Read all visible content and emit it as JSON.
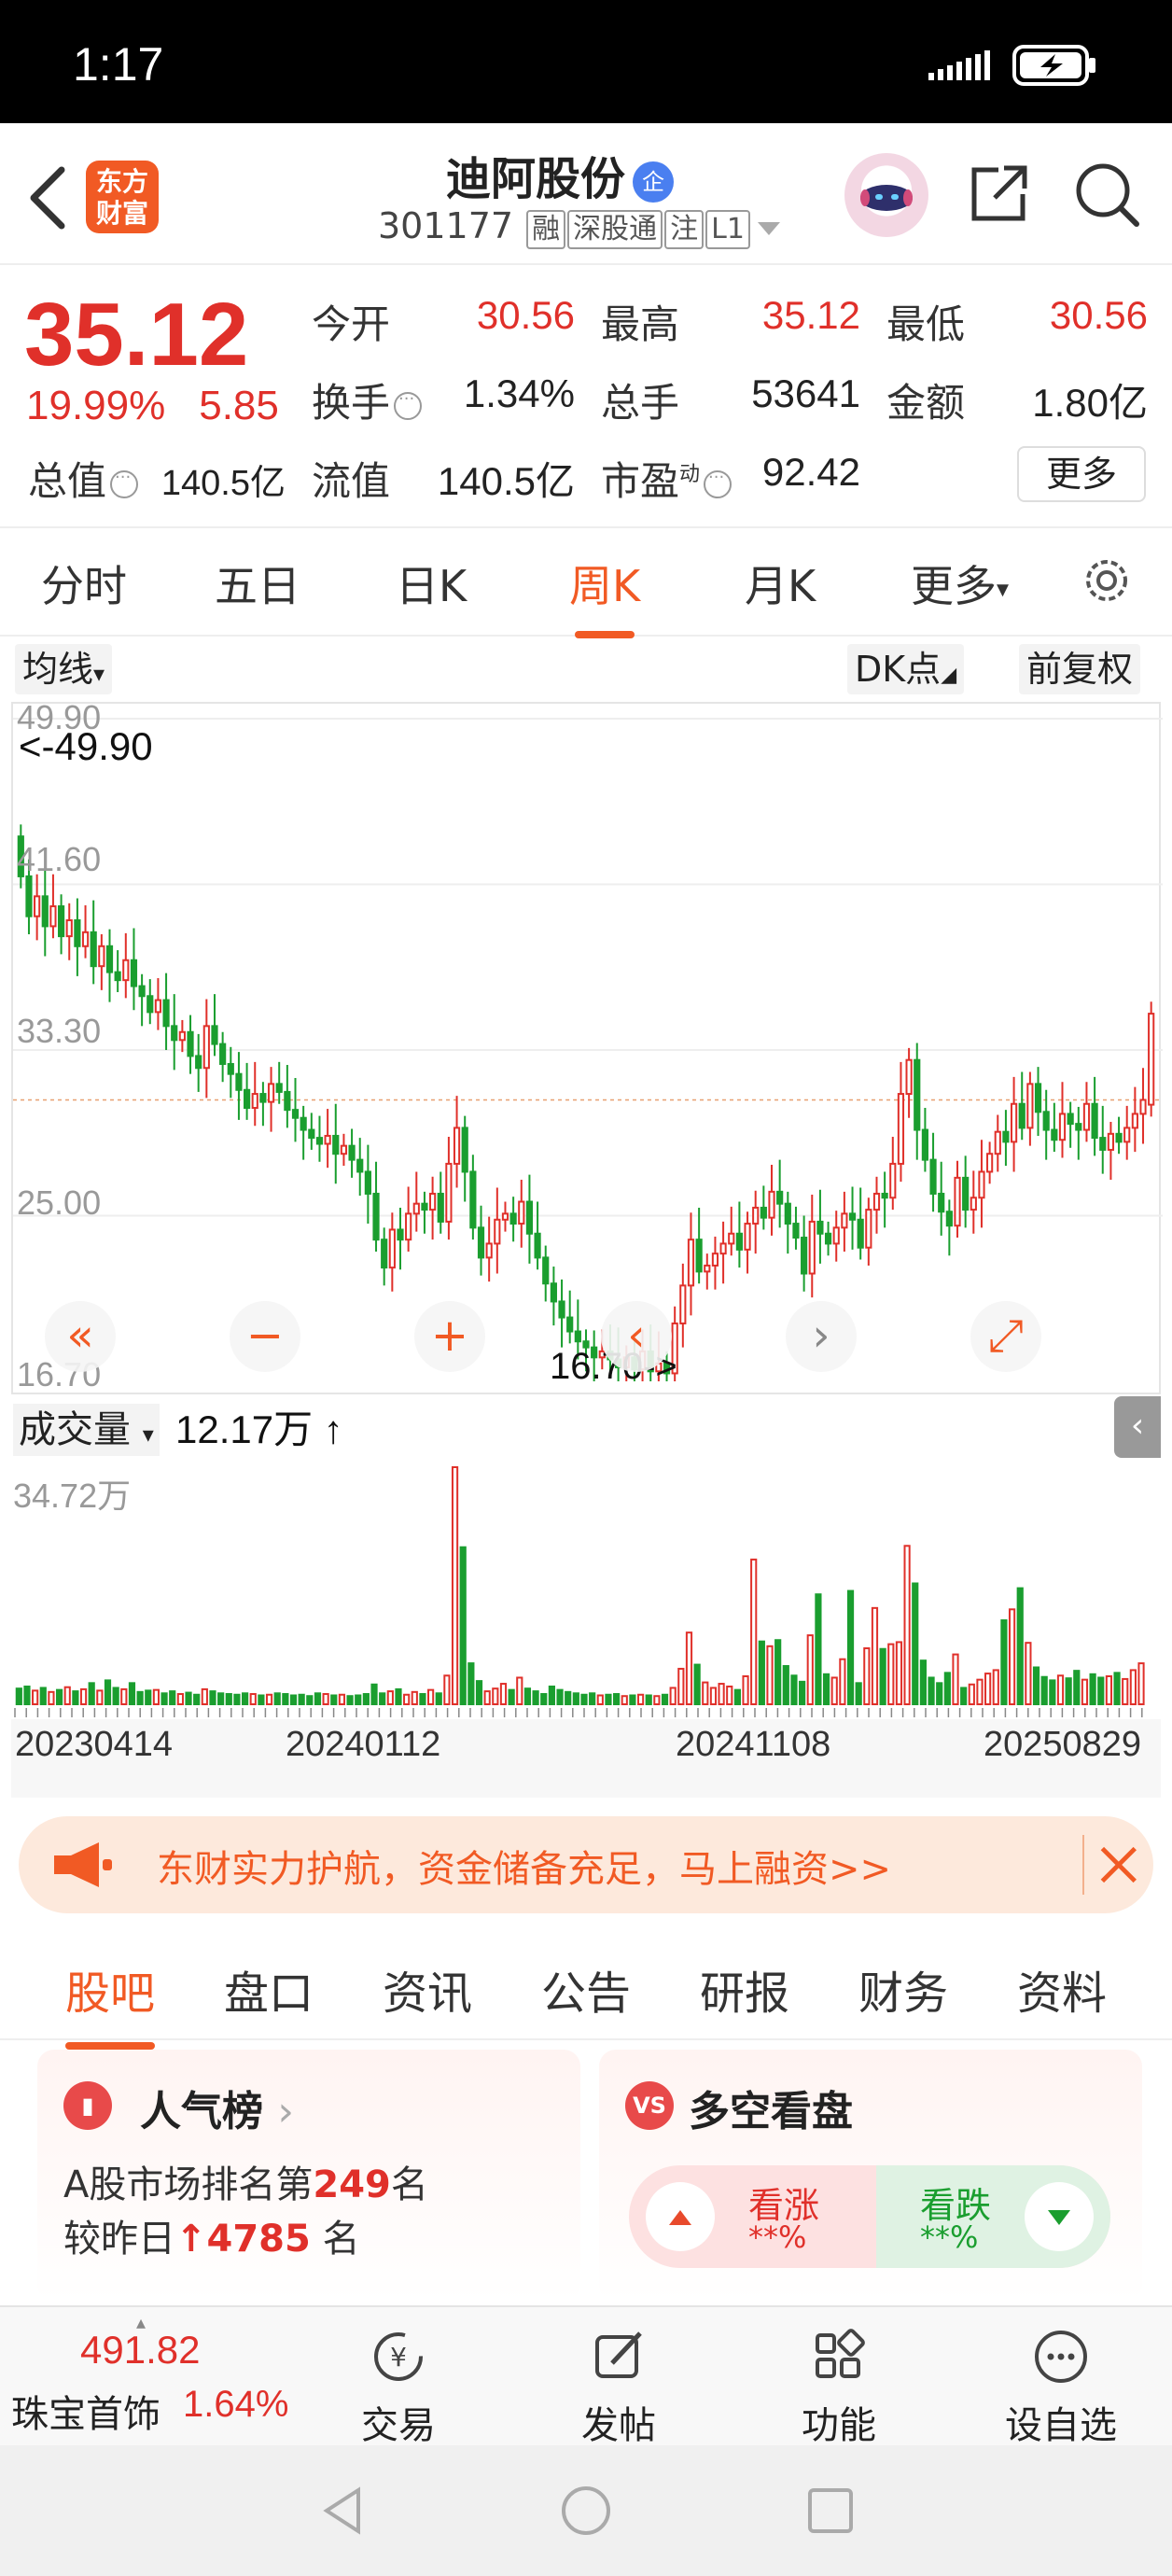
{
  "status_bar": {
    "time": "1:17"
  },
  "header": {
    "logo_line1": "东方",
    "logo_line2": "财富",
    "stock_name": "迪阿股份",
    "name_badge": "企",
    "stock_code": "301177",
    "tags": [
      "融",
      "深股通",
      "注",
      "L1"
    ]
  },
  "quote": {
    "price": "35.12",
    "change_pct": "19.99%",
    "change_amt": "5.85",
    "open_label": "今开",
    "open": "30.56",
    "high_label": "最高",
    "high": "35.12",
    "low_label": "最低",
    "low": "30.56",
    "turnover_label": "换手",
    "turnover": "1.34%",
    "volume_label": "总手",
    "volume": "53641",
    "amount_label": "金额",
    "amount": "1.80亿",
    "mktcap_label": "总值",
    "mktcap": "140.5亿",
    "float_label": "流值",
    "float_cap": "140.5亿",
    "pe_label": "市盈",
    "pe_sup": "动",
    "pe": "92.42",
    "more_label": "更多"
  },
  "kline_tabs": [
    "分时",
    "五日",
    "日K",
    "周K",
    "月K",
    "更多"
  ],
  "kline_active": "周K",
  "chart_options": {
    "indicator": "均线",
    "dk": "DK点",
    "adjust": "前复权"
  },
  "chart_data": {
    "type": "candlestick",
    "period": "weekly",
    "ylim": [
      16.7,
      49.9
    ],
    "y_ticks": [
      "49.90",
      "41.60",
      "33.30",
      "25.00",
      "16.70"
    ],
    "max_note": "<-49.90",
    "min_note": "16.70->",
    "x_labels": [
      "20230414",
      "20240112",
      "20241108",
      "20250829"
    ],
    "close": [
      42,
      40,
      41,
      39.5,
      40.5,
      39,
      39.8,
      38.5,
      39.2,
      37.5,
      38.5,
      37.2,
      36.8,
      37.8,
      36.5,
      36,
      35.2,
      35.8,
      34.5,
      33.8,
      34.2,
      33,
      32.4,
      34.5,
      33.6,
      32.6,
      32.1,
      31.3,
      30.4,
      31.1,
      30.7,
      31.6,
      31.2,
      30.3,
      29.9,
      29.3,
      28.9,
      28.6,
      29,
      28.1,
      28.5,
      27.8,
      27.2,
      26.1,
      23.8,
      22.4,
      24.3,
      23.8,
      25.1,
      25.6,
      25.3,
      26.1,
      24.7,
      27.6,
      29.4,
      27.2,
      24.4,
      22.9,
      23.6,
      24.8,
      25.1,
      24.6,
      25.7,
      24.1,
      22.9,
      21.6,
      20.7,
      19.9,
      19.2,
      18.7,
      18.4,
      17.9,
      18.2,
      17.8,
      17.4,
      17.9,
      17.3,
      18.2,
      17.2,
      17.6,
      17.1,
      19.6,
      21.5,
      23.8,
      22.2,
      22.5,
      23.1,
      23.6,
      24.1,
      23.3,
      24.6,
      25.4,
      24.9,
      26.2,
      25.6,
      24.6,
      23.9,
      22.1,
      24.7,
      24.1,
      23.6,
      24.4,
      25.1,
      24.8,
      23.4,
      25.3,
      26.1,
      25.9,
      27.6,
      31.1,
      32.8,
      29.3,
      27.8,
      26.1,
      25.2,
      24.5,
      26.9,
      25.3,
      25.9,
      27.2,
      28.1,
      29.2,
      28.7,
      30.6,
      29.4,
      31.6,
      30.2,
      29.3,
      28.8,
      30.1,
      29.6,
      29.3,
      30.6,
      28.9,
      28.3,
      29.1,
      28.7,
      29.4,
      30.1,
      30.8,
      35.12
    ],
    "open": [
      44,
      42,
      40,
      41,
      39.5,
      40.5,
      39,
      39.8,
      38.5,
      39.2,
      37.5,
      38.5,
      37.2,
      36.8,
      37.8,
      36.5,
      36,
      35.2,
      35.8,
      34.5,
      33.8,
      34.2,
      33,
      32.4,
      34.5,
      33.6,
      32.6,
      32.1,
      31.3,
      30.4,
      31.1,
      30.7,
      31.6,
      31.2,
      30.3,
      29.9,
      29.3,
      28.9,
      28.6,
      29,
      28.1,
      28.5,
      27.8,
      27.2,
      26.1,
      23.8,
      22.4,
      24.3,
      23.8,
      25.1,
      25.6,
      25.3,
      26.1,
      24.7,
      27.6,
      29.4,
      27.2,
      24.4,
      22.9,
      23.6,
      24.8,
      25.1,
      24.6,
      25.7,
      24.1,
      22.9,
      21.6,
      20.7,
      19.9,
      19.2,
      18.7,
      18.4,
      17.9,
      18.2,
      17.8,
      17.4,
      17.9,
      17.3,
      18.2,
      17.2,
      17.6,
      17.1,
      19.6,
      21.5,
      23.8,
      22.2,
      22.5,
      23.1,
      23.6,
      24.1,
      23.3,
      24.6,
      25.4,
      24.9,
      26.2,
      25.6,
      24.6,
      23.9,
      22.1,
      24.7,
      24.1,
      23.6,
      24.4,
      25.1,
      24.8,
      23.4,
      25.3,
      26.1,
      25.9,
      27.6,
      31.1,
      32.8,
      29.3,
      27.8,
      26.1,
      25.2,
      24.5,
      26.9,
      25.3,
      25.9,
      27.2,
      28.1,
      29.2,
      28.7,
      30.6,
      29.4,
      31.6,
      30.2,
      29.3,
      28.8,
      30.1,
      29.6,
      29.3,
      30.6,
      28.9,
      28.3,
      29.1,
      28.7,
      29.4,
      30.1,
      30.56
    ],
    "volume_label": "成交量",
    "volume_value": "12.17万",
    "volume_max_label": "34.72万",
    "volume_max": 34.72,
    "volume": [
      2.3,
      2.6,
      2.0,
      2.4,
      1.8,
      2.1,
      2.5,
      1.9,
      2.2,
      3.1,
      2.0,
      3.5,
      2.4,
      2.2,
      3.1,
      1.8,
      2.0,
      2.1,
      1.6,
      1.9,
      1.5,
      1.7,
      1.4,
      2.2,
      1.9,
      1.6,
      1.5,
      1.4,
      1.6,
      1.5,
      1.3,
      1.4,
      1.6,
      1.5,
      1.3,
      1.4,
      1.2,
      1.6,
      1.5,
      1.3,
      1.4,
      1.2,
      1.3,
      1.5,
      2.9,
      1.6,
      1.9,
      2.2,
      1.4,
      1.8,
      1.5,
      2.1,
      1.6,
      4.2,
      34.72,
      23.0,
      6.0,
      3.4,
      1.9,
      2.3,
      3.0,
      2.1,
      3.9,
      2.3,
      1.9,
      1.5,
      2.6,
      2.1,
      1.8,
      1.6,
      1.4,
      1.6,
      1.3,
      1.4,
      1.5,
      1.2,
      1.3,
      1.4,
      1.3,
      1.2,
      1.4,
      2.4,
      5.2,
      10.5,
      5.8,
      3.2,
      2.4,
      3.0,
      2.6,
      2.1,
      4.1,
      21.2,
      9.2,
      8.5,
      9.4,
      5.6,
      4.2,
      3.3,
      10.1,
      16.1,
      4.4,
      3.9,
      6.6,
      16.6,
      3.1,
      8.2,
      14.1,
      8.1,
      8.8,
      9.1,
      23.2,
      17.7,
      6.4,
      3.9,
      3.1,
      4.6,
      7.3,
      2.4,
      2.9,
      3.6,
      4.5,
      5.0,
      12.3,
      13.9,
      17.0,
      9.0,
      5.4,
      4.0,
      3.5,
      4.2,
      3.8,
      4.9,
      3.6,
      4.4,
      3.9,
      4.1,
      4.6,
      3.7,
      5.0,
      6.0
    ]
  },
  "chart_controls": [
    "«",
    "−",
    "+",
    "‹",
    "›",
    "⤢"
  ],
  "promo": {
    "text": "东财实力护航，资金储备充足，马上融资>>"
  },
  "bottom_tabs": [
    "股吧",
    "盘口",
    "资讯",
    "公告",
    "研报",
    "财务",
    "资料"
  ],
  "bottom_active": "股吧",
  "popularity": {
    "title": "人气榜",
    "line1_prefix": "A股市场排名第",
    "rank": "249",
    "line1_suffix": "名",
    "line2_prefix": "较昨日",
    "change": "4785",
    "line2_suffix": "名"
  },
  "sentiment": {
    "badge": "VS",
    "title": "多空看盘",
    "bull_label": "看涨",
    "bull_value": "**%",
    "bear_label": "看跌",
    "bear_value": "**%"
  },
  "bottom_nav": {
    "index_value": "491.82",
    "index_name": "珠宝首饰",
    "index_pct": "1.64%",
    "items": [
      "交易",
      "发帖",
      "功能",
      "设自选"
    ]
  },
  "colors": {
    "up": "#e0302a",
    "down": "#1a9e2f",
    "accent": "#f15a24"
  }
}
